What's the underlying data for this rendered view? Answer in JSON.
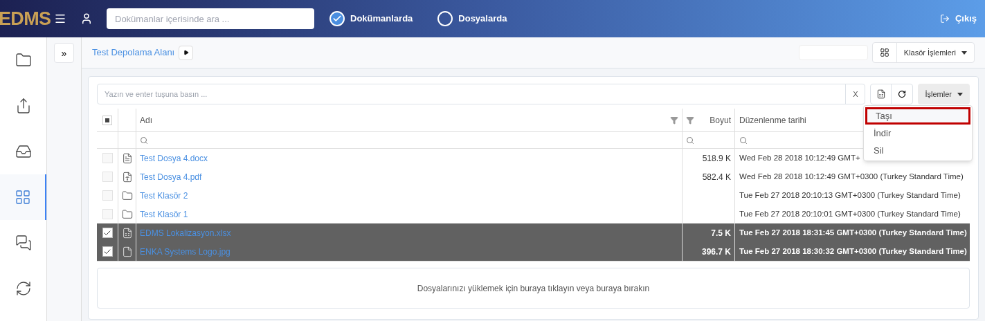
{
  "topbar": {
    "logo": "EDMS",
    "search": {
      "placeholder": "Dokümanlar içerisinde ara ..."
    },
    "scope_options": [
      {
        "label": "Dokümanlarda",
        "selected": true
      },
      {
        "label": "Dosyalarda",
        "selected": false
      }
    ],
    "logout": "Çıkış"
  },
  "sidebar": {
    "items": [
      {
        "selected": false
      },
      {
        "selected": false
      },
      {
        "selected": false
      },
      {
        "selected": true
      },
      {
        "selected": false
      },
      {
        "selected": false
      }
    ]
  },
  "expand_button": "»",
  "breadcrumb": {
    "items": [
      "Test Depolama Alanı"
    ]
  },
  "folder_actions": "Klasör İşlemleri",
  "toolbar": {
    "filter": {
      "placeholder": "Yazın ve enter tuşuna basın ..."
    },
    "clear": "X",
    "actions": "İşlemler"
  },
  "table": {
    "header_checkbox": {
      "indeterminate": true
    },
    "columns": [
      "Adı",
      "Boyut",
      "Düzenlenme tarihi"
    ],
    "rows": [
      {
        "kind": "word",
        "checked": false,
        "name": "Test Dosya 4.docx",
        "size": "518.9 K",
        "modified": "Wed Feb 28 2018 10:12:49 GMT+"
      },
      {
        "kind": "pdf",
        "checked": false,
        "name": "Test Dosya 4.pdf",
        "size": "582.4 K",
        "modified": "Wed Feb 28 2018 10:12:49 GMT+0300 (Turkey Standard Time)"
      },
      {
        "kind": "folder",
        "checked": false,
        "name": "Test Klasör 2",
        "modified": "Tue Feb 27 2018 20:10:13 GMT+0300 (Turkey Standard Time)"
      },
      {
        "kind": "folder",
        "checked": false,
        "name": "Test Klasör 1",
        "modified": "Tue Feb 27 2018 20:10:01 GMT+0300 (Turkey Standard Time)"
      },
      {
        "kind": "excel",
        "checked": true,
        "name": "EDMS Lokalizasyon.xlsx",
        "size": "7.5 K",
        "modified": "Tue Feb 27 2018 18:31:45 GMT+0300 (Turkey Standard Time)"
      },
      {
        "kind": "file",
        "checked": true,
        "name": "ENKA Systems Logo.jpg",
        "size": "396.7 K",
        "modified": "Tue Feb 27 2018 18:30:32 GMT+0300 (Turkey Standard Time)"
      }
    ]
  },
  "actions_menu": {
    "items": [
      {
        "label": "Taşı",
        "selected": true
      },
      {
        "label": "İndir",
        "selected": false
      },
      {
        "label": "Sil",
        "selected": false
      }
    ]
  },
  "dropzone": "Dosyalarınızı yüklemek için buraya tıklayın veya buraya bırakın"
}
